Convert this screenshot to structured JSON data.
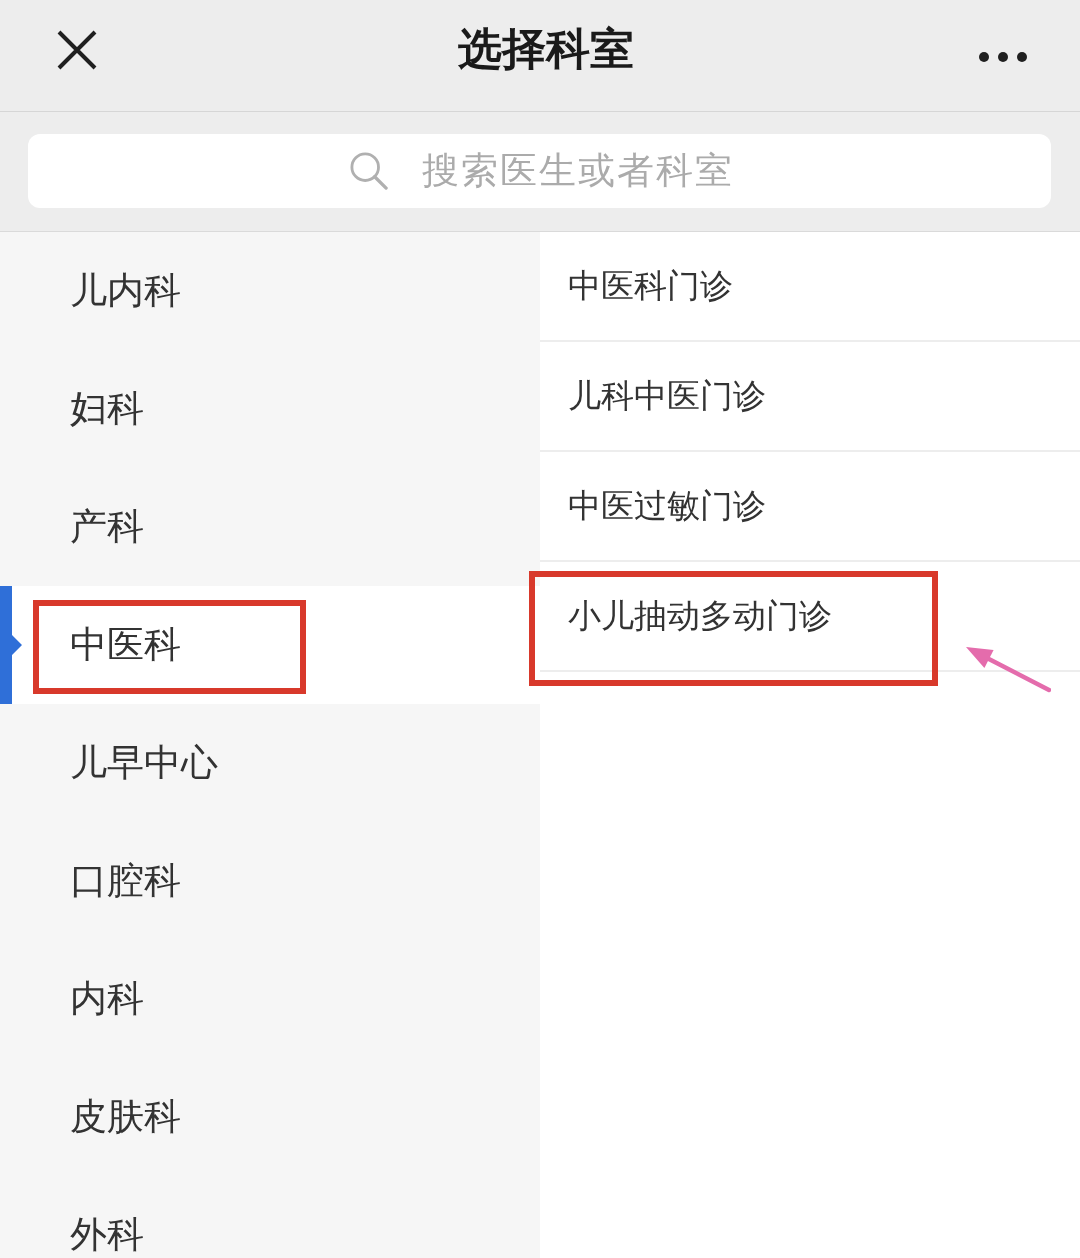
{
  "header": {
    "title": "选择科室"
  },
  "search": {
    "placeholder": "搜索医生或者科室"
  },
  "departments": [
    {
      "label": "儿内科",
      "selected": false,
      "highlighted": false
    },
    {
      "label": "妇科",
      "selected": false,
      "highlighted": false
    },
    {
      "label": "产科",
      "selected": false,
      "highlighted": false
    },
    {
      "label": "中医科",
      "selected": true,
      "highlighted": true
    },
    {
      "label": "儿早中心",
      "selected": false,
      "highlighted": false
    },
    {
      "label": "口腔科",
      "selected": false,
      "highlighted": false
    },
    {
      "label": "内科",
      "selected": false,
      "highlighted": false
    },
    {
      "label": "皮肤科",
      "selected": false,
      "highlighted": false
    },
    {
      "label": "外科",
      "selected": false,
      "highlighted": false
    }
  ],
  "clinics": [
    {
      "label": "中医科门诊",
      "highlighted": false,
      "pointed": false
    },
    {
      "label": "儿科中医门诊",
      "highlighted": false,
      "pointed": false
    },
    {
      "label": "中医过敏门诊",
      "highlighted": false,
      "pointed": false
    },
    {
      "label": "小儿抽动多动门诊",
      "highlighted": true,
      "pointed": true
    }
  ]
}
